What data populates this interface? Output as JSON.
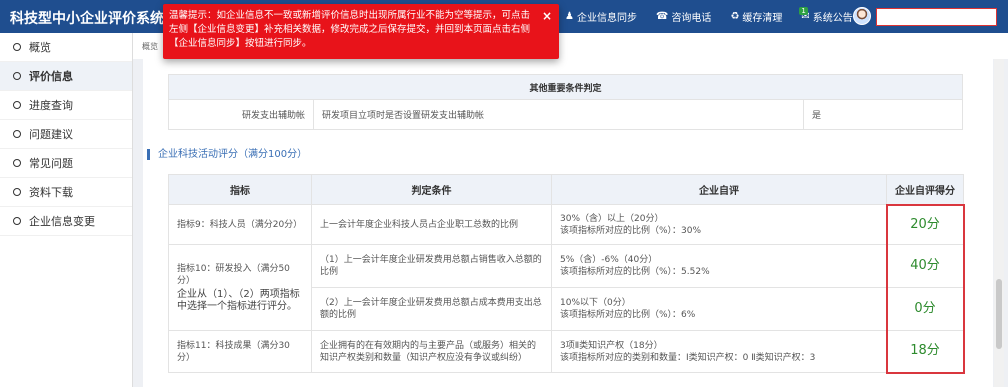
{
  "header": {
    "app_title": "科技型中小企业评价系统",
    "nav": [
      {
        "icon": "user-icon",
        "label": "企业信息同步"
      },
      {
        "icon": "phone-icon",
        "label": "咨询电话"
      },
      {
        "icon": "recycle-icon",
        "label": "缓存清理"
      },
      {
        "icon": "mail-icon",
        "label": "系统公告",
        "badge": "1"
      }
    ],
    "user_field_value": ""
  },
  "toast": {
    "message": "温馨提示：如企业信息不一致或新增评价信息时出现所属行业不能为空等提示，可点击左侧【企业信息变更】补充相关数据，修改完成之后保存提交，并回到本页面点击右侧【企业信息同步】按钮进行同步。",
    "close_label": "×"
  },
  "breadcrumb": "概览",
  "sidebar": {
    "items": [
      {
        "label": "概览"
      },
      {
        "label": "评价信息"
      },
      {
        "label": "进度查询"
      },
      {
        "label": "问题建议"
      },
      {
        "label": "常见问题"
      },
      {
        "label": "资料下载"
      },
      {
        "label": "企业信息变更"
      }
    ]
  },
  "other_conditions": {
    "header": "其他重要条件判定",
    "row": {
      "label": "研发支出辅助帐",
      "condition": "研发项目立项时是否设置研发支出辅助帐",
      "value": "是"
    }
  },
  "section_title": "企业科技活动评分（满分100分）",
  "score_table": {
    "headers": [
      "指标",
      "判定条件",
      "企业自评",
      "企业自评得分"
    ],
    "rows": [
      {
        "indicator": "指标9：科技人员（满分20分）",
        "condition": "上一会计年度企业科技人员占企业职工总数的比例",
        "self_eval_1": "30%（含）以上（20分）",
        "self_eval_2": "该项指标所对应的比例（%）：30%",
        "score": "20分"
      },
      {
        "indicator": "指标10：研发投入（满分50分）",
        "indicator_note": "企业从（1）、（2）两项指标中选择一个指标进行评分。",
        "condition": "（1）上一会计年度企业研发费用总额占销售收入总额的比例",
        "self_eval_1": "5%（含）-6%（40分）",
        "self_eval_2": "该项指标所对应的比例（%）：5.52%",
        "score": "40分"
      },
      {
        "condition": "（2）上一会计年度企业研发费用总额占成本费用支出总额的比例",
        "self_eval_1": "10%以下（0分）",
        "self_eval_2": "该项指标所对应的比例（%）：6%",
        "score": "0分"
      },
      {
        "indicator": "指标11：科技成果（满分30分）",
        "condition": "企业拥有的在有效期内的与主要产品（或服务）相关的知识产权类别和数量（知识产权应没有争议或纠纷）",
        "self_eval_1": "3项Ⅱ类知识产权（18分）",
        "self_eval_2": "该项指标所对应的类别和数量：Ⅰ类知识产权：0 Ⅱ类知识产权：3",
        "score": "18分"
      }
    ]
  },
  "colors": {
    "header_bg": "#1f4e8f",
    "toast_bg": "#e8131a",
    "score_green": "#2e8b2e",
    "highlight_red": "#d9363e"
  }
}
